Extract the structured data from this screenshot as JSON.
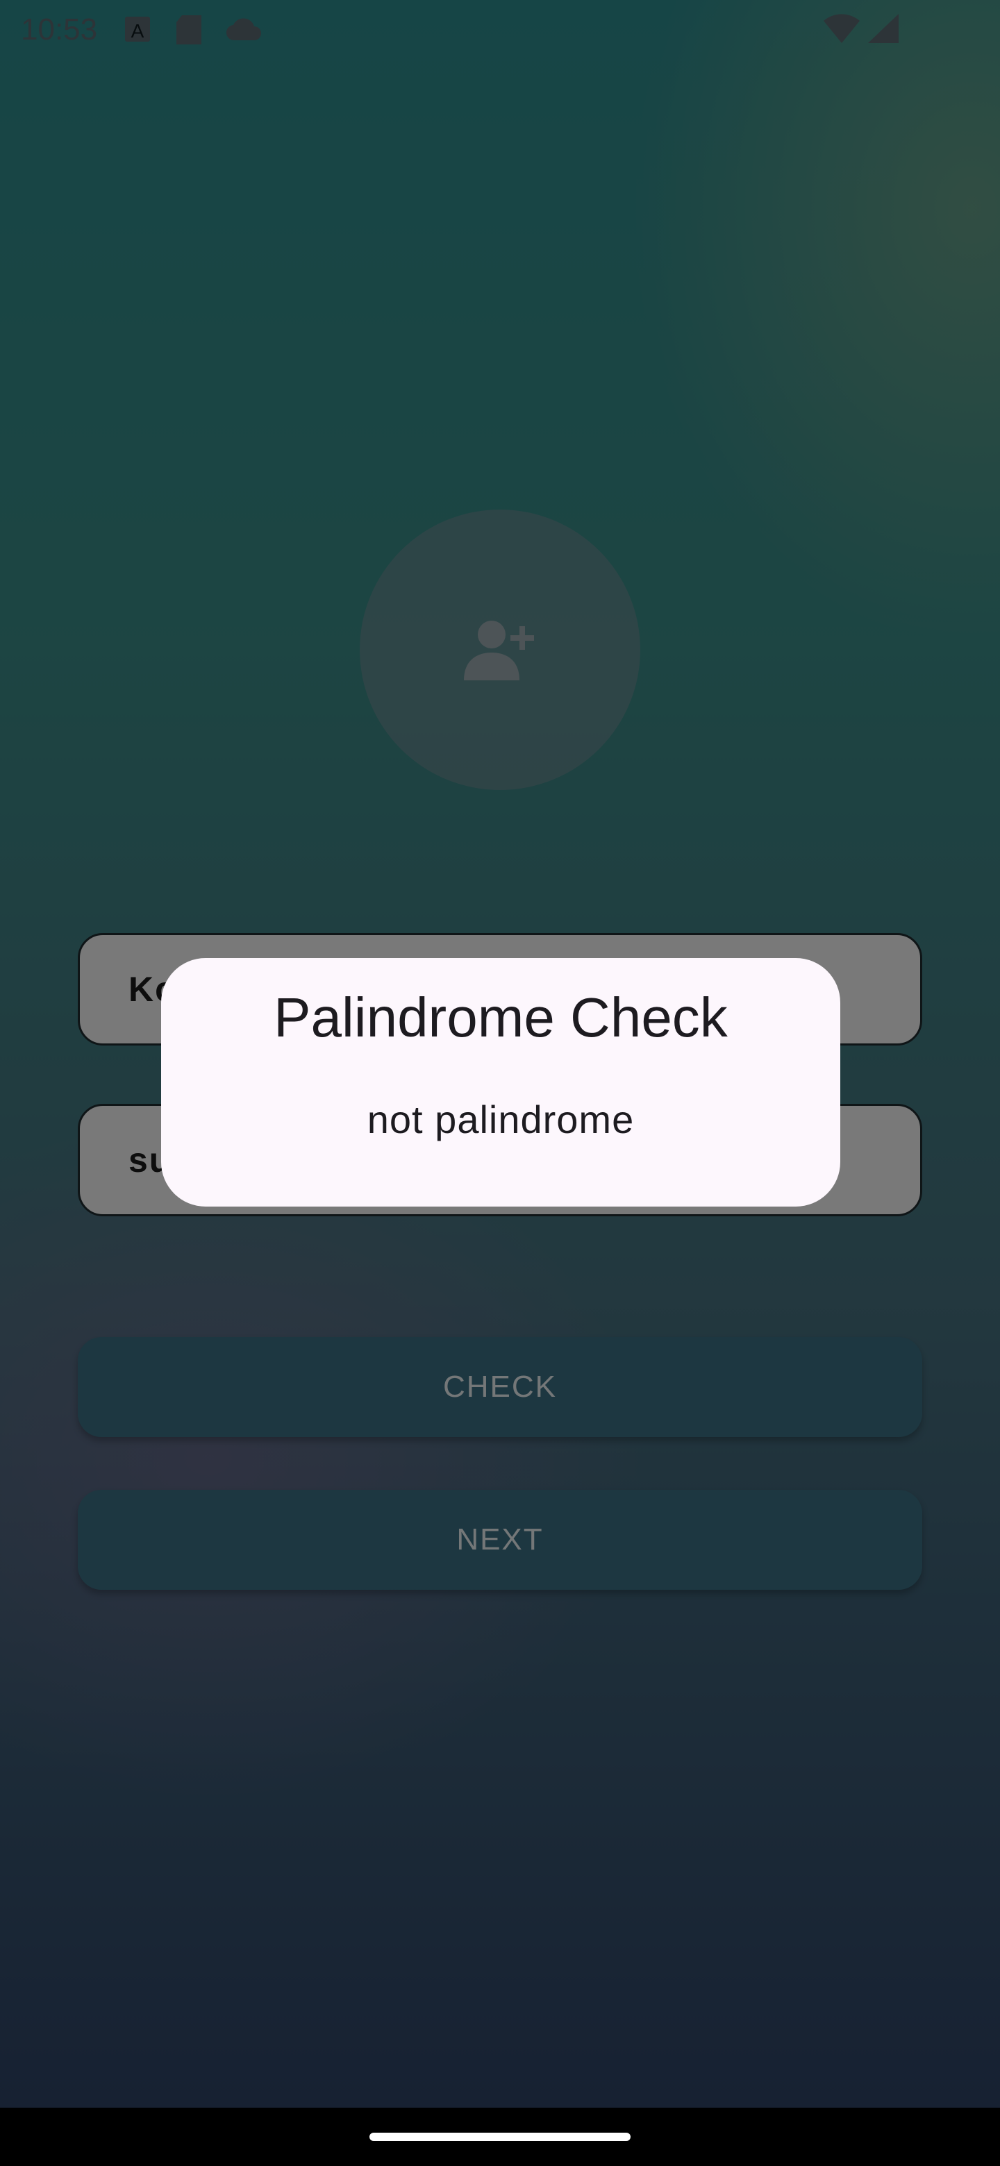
{
  "status_bar": {
    "time": "10:53",
    "icons": [
      "font-icon",
      "sd-card-icon",
      "cloud-icon",
      "wifi-icon",
      "signal-icon"
    ]
  },
  "avatar": {
    "icon": "add-person-icon"
  },
  "form": {
    "name_value": "Kc",
    "second_value": "su"
  },
  "buttons": {
    "check_label": "CHECK",
    "next_label": "NEXT"
  },
  "dialog": {
    "title": "Palindrome Check",
    "message": "not palindrome"
  }
}
